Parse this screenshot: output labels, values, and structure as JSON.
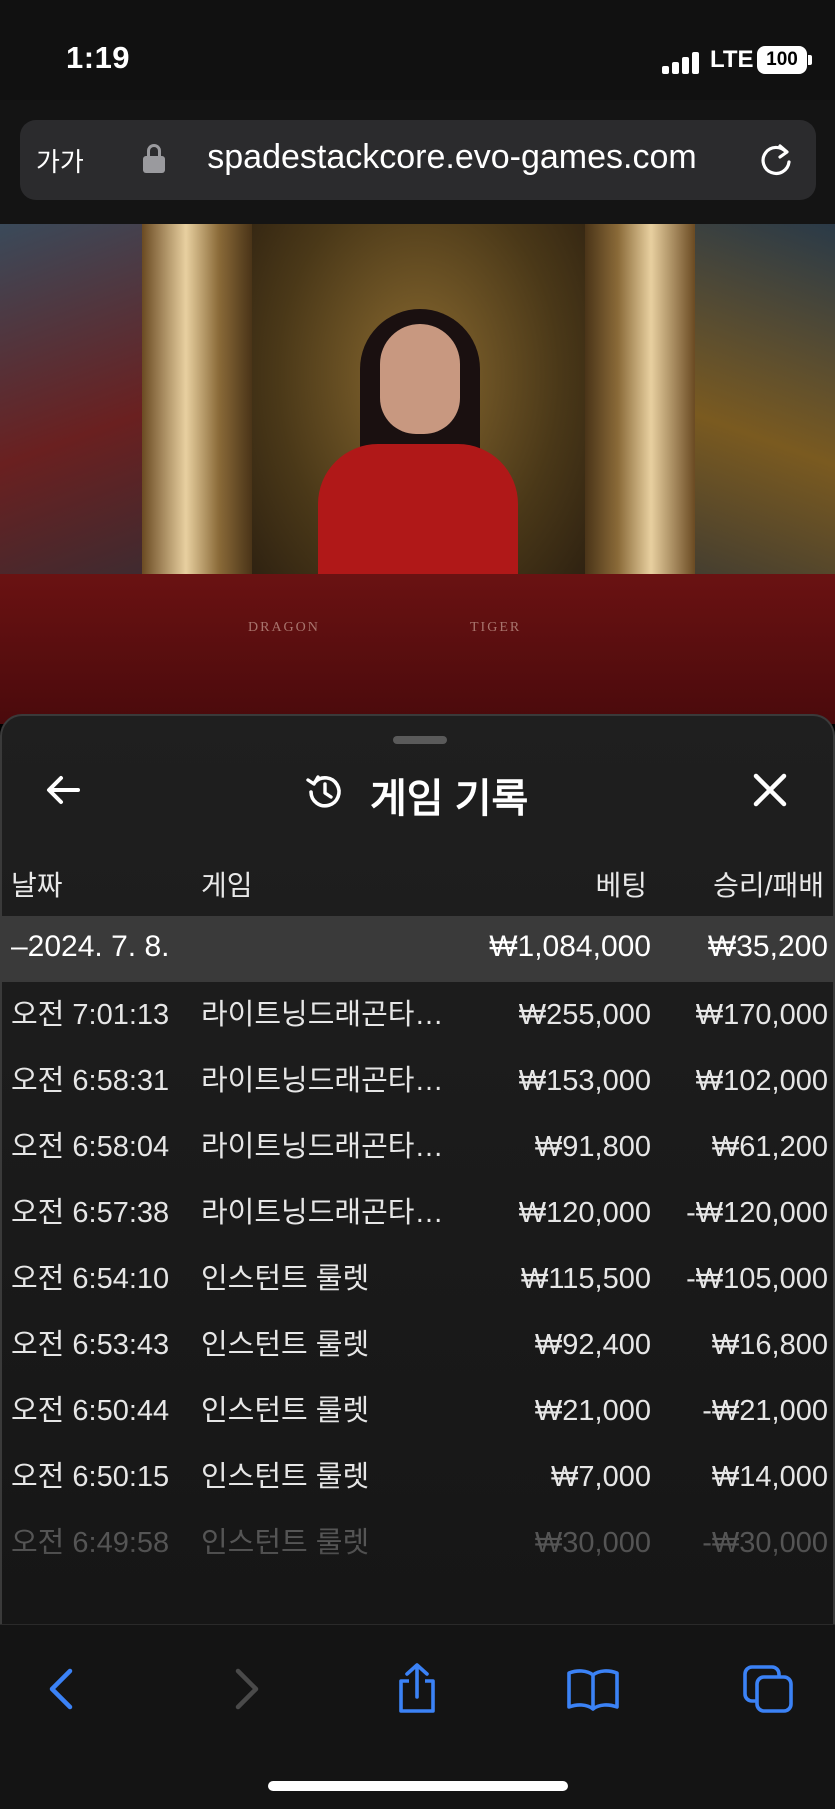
{
  "status": {
    "time": "1:19",
    "network": "LTE",
    "battery": "100"
  },
  "browser": {
    "text_size_label": "가가",
    "url": "spadestackcore.evo-games.com"
  },
  "video": {
    "table_left_label": "DRAGON",
    "table_right_label": "TIGER"
  },
  "sheet": {
    "title": "게임 기록",
    "columns": {
      "date": "날짜",
      "game": "게임",
      "bet": "베팅",
      "win_loss": "승리/패배"
    },
    "date_group": {
      "date": "–2024. 7. 8.",
      "bet_total": "₩1,084,000",
      "win_loss_total": "₩35,200"
    },
    "rows": [
      {
        "time": "오전 7:01:13",
        "game": "라이트닝드래곤타이거",
        "bet": "₩255,000",
        "win_loss": "₩170,000"
      },
      {
        "time": "오전 6:58:31",
        "game": "라이트닝드래곤타이거",
        "bet": "₩153,000",
        "win_loss": "₩102,000"
      },
      {
        "time": "오전 6:58:04",
        "game": "라이트닝드래곤타이거",
        "bet": "₩91,800",
        "win_loss": "₩61,200"
      },
      {
        "time": "오전 6:57:38",
        "game": "라이트닝드래곤타이거",
        "bet": "₩120,000",
        "win_loss": "-₩120,000"
      },
      {
        "time": "오전 6:54:10",
        "game": "인스턴트 룰렛",
        "bet": "₩115,500",
        "win_loss": "-₩105,000"
      },
      {
        "time": "오전 6:53:43",
        "game": "인스턴트 룰렛",
        "bet": "₩92,400",
        "win_loss": "₩16,800"
      },
      {
        "time": "오전 6:50:44",
        "game": "인스턴트 룰렛",
        "bet": "₩21,000",
        "win_loss": "-₩21,000"
      },
      {
        "time": "오전 6:50:15",
        "game": "인스턴트 룰렛",
        "bet": "₩7,000",
        "win_loss": "₩14,000"
      },
      {
        "time": "오전 6:49:58",
        "game": "인스턴트 룰렛",
        "bet": "₩30,000",
        "win_loss": "-₩30,000"
      }
    ]
  },
  "toolbar": {
    "icons": [
      "back-chevron-icon",
      "forward-chevron-icon",
      "share-icon",
      "bookmarks-icon",
      "tabs-icon"
    ]
  },
  "colors": {
    "accent_blue": "#3b82f6",
    "sheet_bg": "#1a1a1a",
    "date_row_bg": "#3a3a3a"
  }
}
